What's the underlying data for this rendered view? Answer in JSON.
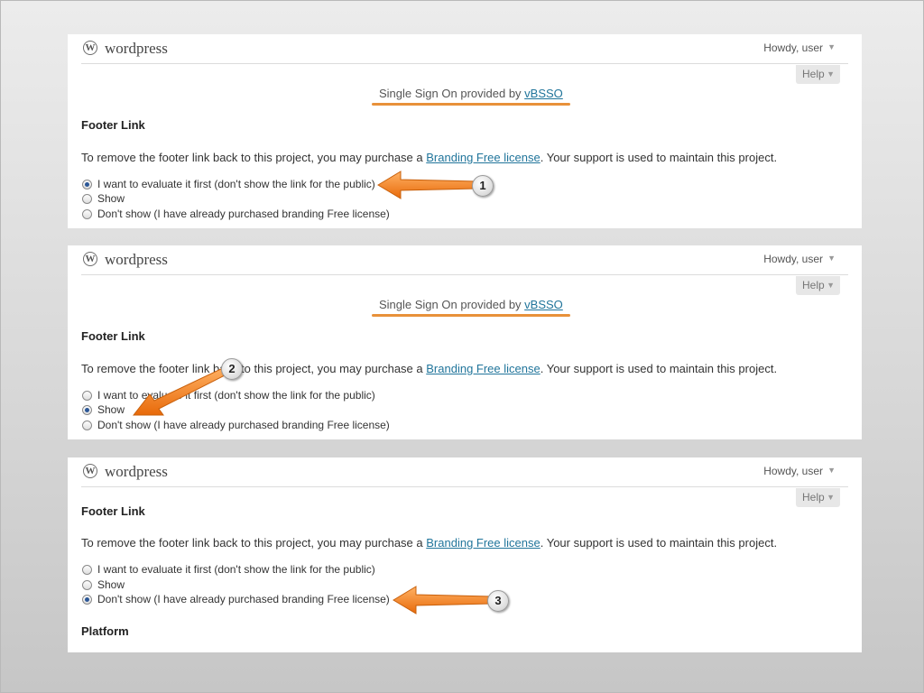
{
  "panels": [
    {
      "site_title": "wordpress",
      "howdy": "Howdy, user",
      "help": "Help",
      "sso_text": "Single Sign On provided by",
      "sso_link": "vBSSO",
      "section_title": "Footer Link",
      "desc_before": "To remove the footer link back to this project, you may purchase a",
      "desc_link": "Branding Free license",
      "desc_after": ". Your support is used to maintain this project.",
      "options": [
        {
          "label": "I want to evaluate it first (don't show the link for the public)",
          "checked": true
        },
        {
          "label": "Show",
          "checked": false
        },
        {
          "label": "Don't show (I have already purchased branding Free license)",
          "checked": false
        }
      ],
      "callout": "1"
    },
    {
      "site_title": "wordpress",
      "howdy": "Howdy, user",
      "help": "Help",
      "sso_text": "Single Sign On provided by",
      "sso_link": "vBSSO",
      "section_title": "Footer Link",
      "desc_before": "To remove the footer link back to this project, you may purchase a",
      "desc_link": "Branding Free license",
      "desc_after": ". Your support is used to maintain this project.",
      "options": [
        {
          "label": "I want to evaluate it first (don't show the link for the public)",
          "checked": false
        },
        {
          "label": "Show",
          "checked": true
        },
        {
          "label": "Don't show (I have already purchased branding Free license)",
          "checked": false
        }
      ],
      "callout": "2"
    },
    {
      "site_title": "wordpress",
      "howdy": "Howdy, user",
      "help": "Help",
      "section_title": "Footer Link",
      "desc_before": "To remove the footer link back to this project, you may purchase a",
      "desc_link": "Branding Free license",
      "desc_after": ". Your support is used to maintain this project.",
      "options": [
        {
          "label": "I want to evaluate it first (don't show the link for the public)",
          "checked": false
        },
        {
          "label": "Show",
          "checked": false
        },
        {
          "label": "Don't show (I have already purchased branding Free license)",
          "checked": true
        }
      ],
      "callout": "3",
      "platform_title": "Platform"
    }
  ],
  "colors": {
    "link": "#21759b",
    "annotation_arrow": "#f0801e",
    "sso_underline": "#e8913a",
    "radio_checked": "#2b5797"
  },
  "icons": {
    "logo": "wordpress-logo-icon",
    "dropdown": "triangle-down-icon",
    "annotation": "orange-arrow-icon"
  }
}
